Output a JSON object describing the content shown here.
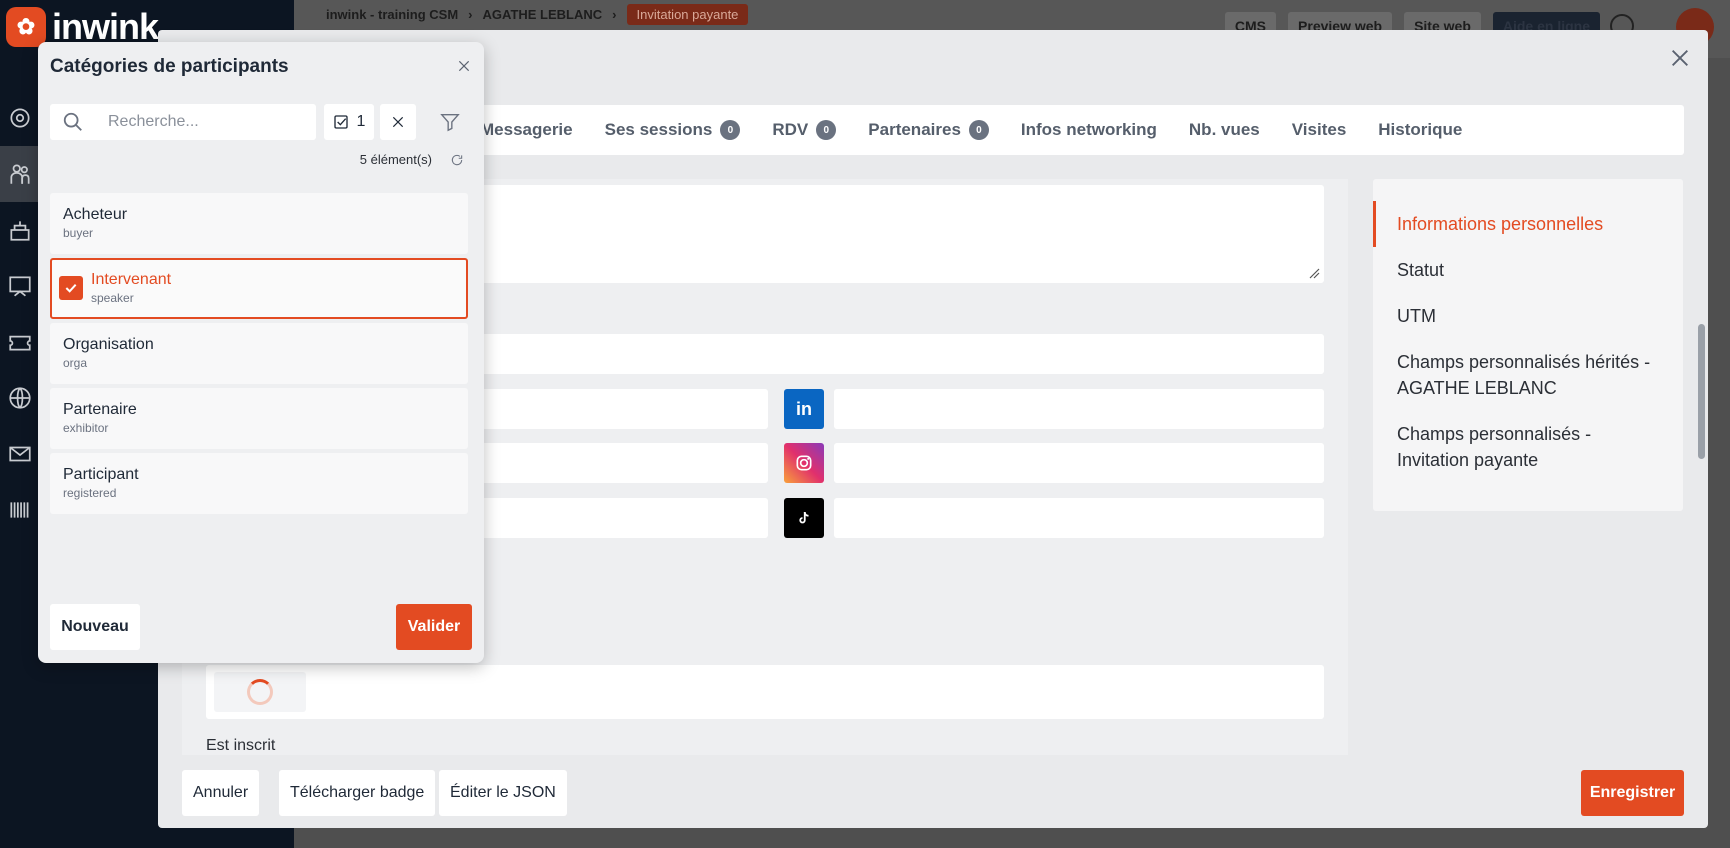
{
  "app": {
    "logo_text": "inwink"
  },
  "breadcrumb": {
    "items": [
      "inwink - training CSM",
      "AGATHE LEBLANC"
    ],
    "badge": "Invitation payante"
  },
  "topbar": {
    "buttons": [
      "CMS",
      "Preview web",
      "Site web",
      "Aide en ligne"
    ]
  },
  "tabs": [
    {
      "label": "Messagerie",
      "count": null
    },
    {
      "label": "Ses sessions",
      "count": "0"
    },
    {
      "label": "RDV",
      "count": "0"
    },
    {
      "label": "Partenaires",
      "count": "0"
    },
    {
      "label": "Infos networking",
      "count": null
    },
    {
      "label": "Nb. vues",
      "count": null
    },
    {
      "label": "Visites",
      "count": null
    },
    {
      "label": "Historique",
      "count": null
    }
  ],
  "form": {
    "est_inscrit_label": "Est inscrit"
  },
  "side_nav": {
    "items": [
      "Informations personnelles",
      "Statut",
      "UTM",
      "Champs personnalisés hérités - AGATHE LEBLANC",
      "Champs personnalisés - Invitation payante"
    ],
    "active_index": 0
  },
  "footer": {
    "cancel": "Annuler",
    "download_badge": "Télécharger badge",
    "edit_json": "Éditer le JSON",
    "save": "Enregistrer"
  },
  "category_panel": {
    "title": "Catégories de participants",
    "search_placeholder": "Recherche...",
    "selected_count": "1",
    "element_count": "5 élément(s)",
    "items": [
      {
        "label": "Acheteur",
        "code": "buyer",
        "selected": false
      },
      {
        "label": "Intervenant",
        "code": "speaker",
        "selected": true
      },
      {
        "label": "Organisation",
        "code": "orga",
        "selected": false
      },
      {
        "label": "Partenaire",
        "code": "exhibitor",
        "selected": false
      },
      {
        "label": "Participant",
        "code": "registered",
        "selected": false
      }
    ],
    "new_button": "Nouveau",
    "validate_button": "Valider"
  },
  "colors": {
    "accent": "#e34b22",
    "sidebar": "#0c1522",
    "linkedin": "#0a66c2"
  }
}
